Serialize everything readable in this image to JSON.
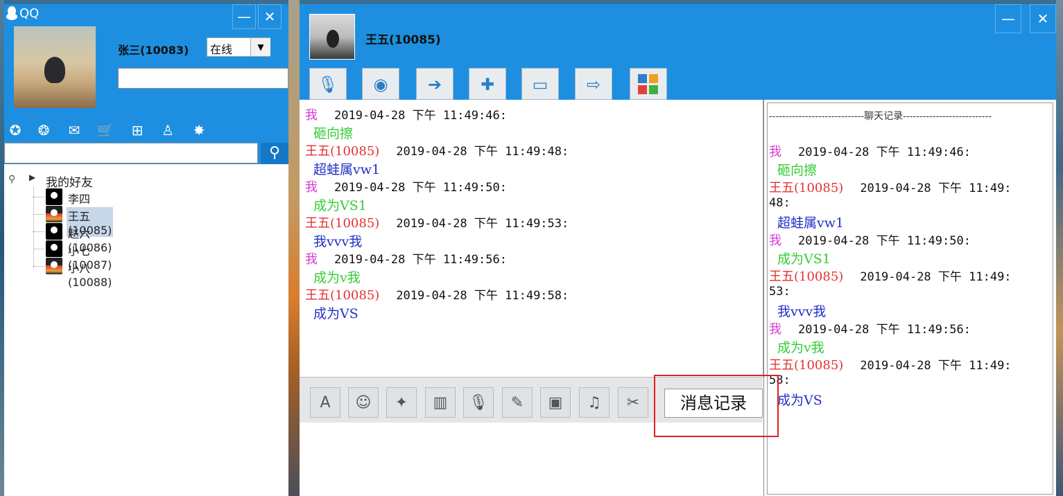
{
  "qq_window": {
    "title": "QQ",
    "minimize_label": "—",
    "close_label": "✕",
    "user_name": "张三(10083)",
    "status": "在线",
    "signature": "",
    "search_placeholder": "",
    "toolbar_icons": [
      "star-icon",
      "qzone-icon",
      "mail-icon",
      "shop-icon",
      "archive-icon",
      "penguin-icon",
      "game-icon"
    ],
    "group_label": "我的好友",
    "friends": [
      {
        "name": "李四(10084)",
        "avatar": "gray",
        "selected": false
      },
      {
        "name": "王五(10085)",
        "avatar": "color",
        "selected": true
      },
      {
        "name": "赵六(10086)",
        "avatar": "gray",
        "selected": false
      },
      {
        "name": "小七(10087)",
        "avatar": "gray",
        "selected": false
      },
      {
        "name": "小八(10088)",
        "avatar": "color",
        "selected": false
      }
    ]
  },
  "chat_window": {
    "title": "王五(10085)",
    "minimize_label": "—",
    "close_label": "✕",
    "top_tools": [
      "microphone-icon",
      "camera-icon",
      "send-file-icon",
      "new-message-icon",
      "remote-desktop-icon",
      "share-screen-icon",
      "apps-icon"
    ],
    "messages": [
      {
        "sender": "我",
        "time": "2019-04-28 下午 11:49:46:",
        "text": "砸向擦",
        "me": true
      },
      {
        "sender": "王五(10085)",
        "time": "2019-04-28 下午 11:49:48:",
        "text": "超蛙属vw1",
        "me": false
      },
      {
        "sender": "我",
        "time": "2019-04-28 下午 11:49:50:",
        "text": "成为VS1",
        "me": true
      },
      {
        "sender": "王五(10085)",
        "time": "2019-04-28 下午 11:49:53:",
        "text": "我vvv我",
        "me": false
      },
      {
        "sender": "我",
        "time": "2019-04-28 下午 11:49:56:",
        "text": "成为v我",
        "me": true
      },
      {
        "sender": "王五(10085)",
        "time": "2019-04-28 下午 11:49:58:",
        "text": "成为VS",
        "me": false
      }
    ],
    "history_header": "-----------------------------聊天记录---------------------------",
    "history": [
      {
        "sender": "我",
        "time": "2019-04-28 下午 11:49:46:",
        "text": "砸向擦",
        "me": true
      },
      {
        "sender": "王五(10085)",
        "time": "2019-04-28 下午 11:49:",
        "time_wrap": "48:",
        "text": "超蛙属vw1",
        "me": false
      },
      {
        "sender": "我",
        "time": "2019-04-28 下午 11:49:50:",
        "text": "成为VS1",
        "me": true
      },
      {
        "sender": "王五(10085)",
        "time": "2019-04-28 下午 11:49:",
        "time_wrap": "53:",
        "text": "我vvv我",
        "me": false
      },
      {
        "sender": "我",
        "time": "2019-04-28 下午 11:49:56:",
        "text": "成为v我",
        "me": true
      },
      {
        "sender": "王五(10085)",
        "time": "2019-04-28 下午 11:49:",
        "time_wrap": "58:",
        "text": "成为VS",
        "me": false
      }
    ],
    "bottom_tools": [
      "font-icon",
      "emoji-icon",
      "magic-icon",
      "shake-icon",
      "voice-icon",
      "edit-icon",
      "image-icon",
      "music-icon",
      "screenshot-icon"
    ],
    "history_button": "消息记录"
  },
  "colors": {
    "blue": "#1e8fe0",
    "me_sender": "#d63ad6",
    "me_text": "#33cc33",
    "peer_sender": "#e53030",
    "peer_text": "#2030c8",
    "highlight": "#e02020"
  }
}
